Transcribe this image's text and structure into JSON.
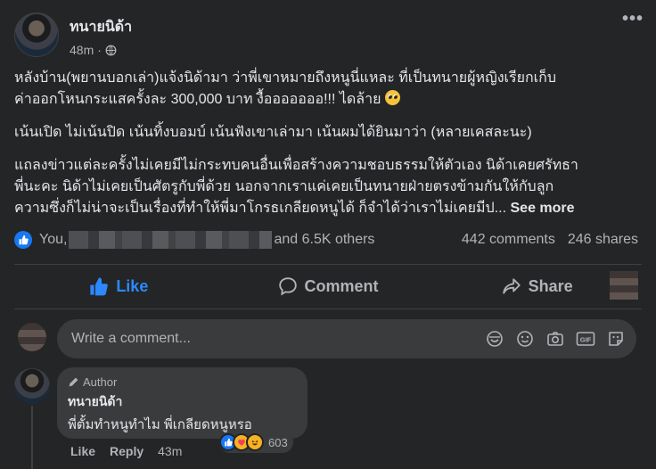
{
  "post": {
    "author": "ทนายนิด้า",
    "time": "48m",
    "visibility_icon": "globe-icon",
    "more_label": "•••",
    "paragraphs": [
      {
        "line1": "หลังบ้าน(พยานบอกเล่า)แจ้งนิด้ามา ว่าพี่เขาหมายถึงหนูนี่แหละ ที่เป็นทนายผู้หญิงเรียกเก็บ",
        "line2": "ค่าออกโหนกระแสครั้งละ 300,000 บาท งื้อออออออ!!! ไดล้าย"
      },
      {
        "line1": "เน้นเปิด ไม่เน้นปิด เน้นทิ้งบอมบ์ เน้นฟังเขาเล่ามา เน้นผมได้ยินมาว่า (หลายเคสละนะ)"
      },
      {
        "line1": "แถลงข่าวแต่ละครั้งไม่เคยมีไม่กระทบคนอื่นเพื่อสร้างความชอบธรรมให้ตัวเอง นิด้าเคยศรัทธา",
        "line2": "พี่นะคะ นิด้าไม่เคยเป็นศัตรูกับพี่ด้วย นอกจากเราแค่เคยเป็นทนายฝ่ายตรงข้ามกันให้กับลูก",
        "line3": "ความซึ่งก็ไม่น่าจะเป็นเรื่องที่ทำให้พี่มาโกรธเกลียดหนูได้ ก็จำได้ว่าเราไม่เคยมีป..."
      }
    ],
    "see_more": "See more"
  },
  "stats": {
    "you": "You,",
    "others": "and 6.5K others",
    "comments": "442 comments",
    "shares": "246 shares"
  },
  "actions": {
    "like": "Like",
    "comment": "Comment",
    "share": "Share"
  },
  "comment_input": {
    "placeholder": "Write a comment..."
  },
  "comment": {
    "badge": "Author",
    "author": "ทนายนิด้า",
    "text": "พี่ตั้มทำหนูทำไม  พี่เกลียดหนูหรอ",
    "reaction_count": "603",
    "like": "Like",
    "reply": "Reply",
    "time": "43m"
  },
  "colors": {
    "background": "#242526",
    "like_blue": "#2d88ff",
    "input_bg": "#3a3b3c",
    "secondary_text": "#b0b3b8"
  }
}
